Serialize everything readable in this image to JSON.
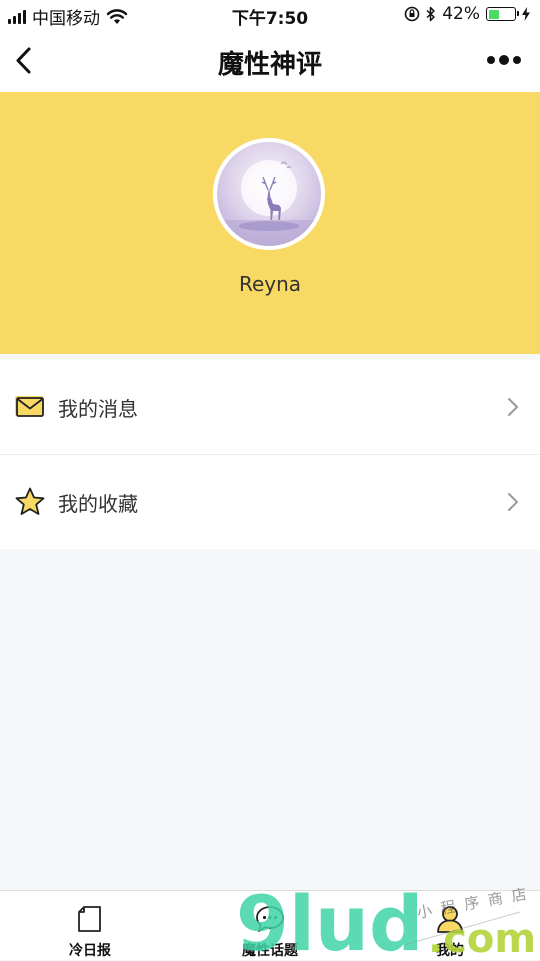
{
  "status_bar": {
    "carrier": "中国移动",
    "time": "下午7:50",
    "battery_percent": "42%",
    "battery_level": 0.42
  },
  "nav": {
    "title": "魔性神评"
  },
  "profile": {
    "username": "Reyna"
  },
  "menu": [
    {
      "label": "我的消息",
      "icon": "envelope-icon"
    },
    {
      "label": "我的收藏",
      "icon": "star-icon"
    }
  ],
  "tabs": [
    {
      "label": "冷日报",
      "icon": "document-icon"
    },
    {
      "label": "魔性话题",
      "icon": "chat-bubble-icon"
    },
    {
      "label": "我的",
      "icon": "user-icon",
      "active": true
    }
  ],
  "watermark": {
    "brand": "9lud",
    "domain": ".com",
    "tagline": "小程序商店"
  },
  "colors": {
    "header_bg": "#F8D964",
    "page_bg": "#F6F7F9",
    "accent": "#F5C542",
    "battery": "#4CD964"
  }
}
